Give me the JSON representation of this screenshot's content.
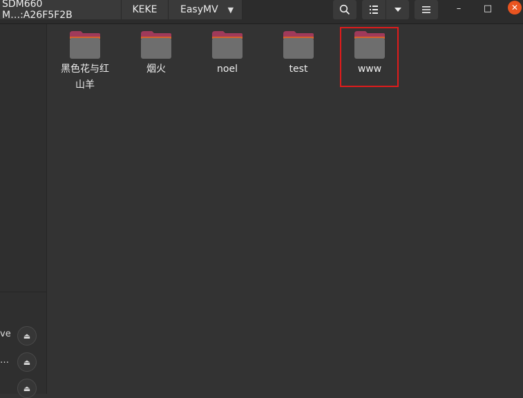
{
  "header": {
    "breadcrumbs": [
      "SDM660 M…:A26F5F2B",
      "KEKE",
      "EasyMV"
    ],
    "search_icon": "search-icon",
    "view_icon": "list-view-icon",
    "view_dropdown_icon": "chevron-down-icon",
    "menu_icon": "hamburger-menu-icon",
    "window_controls": {
      "minimize": "–",
      "maximize": "□",
      "close": "✕"
    }
  },
  "sidebar": {
    "partial_glyph": "ꞏ",
    "items": [
      {
        "label": "ve"
      },
      {
        "label": "…"
      },
      {
        "label": ""
      }
    ],
    "eject_icon": "⏏"
  },
  "files": [
    {
      "name": "黑色花与红山羊"
    },
    {
      "name": "烟火"
    },
    {
      "name": "noel"
    },
    {
      "name": "test"
    },
    {
      "name": "www"
    }
  ],
  "colors": {
    "accent": "#e95420",
    "highlight_box": "#e01b1b",
    "folder_tab": "#a03a5a",
    "folder_body": "#6e6e6e"
  }
}
